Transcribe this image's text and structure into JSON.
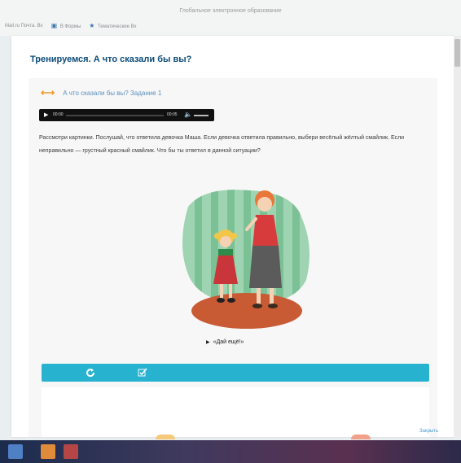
{
  "browser": {
    "window_title": "Глобальное электронное образование",
    "bookmarks": [
      {
        "label": "Mail.ru Почта. Вх",
        "icon": "mail-icon"
      },
      {
        "label": "В Формы",
        "icon": "forms-icon"
      },
      {
        "label": "Тематические Вх",
        "icon": "bookmark-icon"
      }
    ]
  },
  "page": {
    "title": "Тренируемся. А что сказали бы вы?",
    "task": {
      "icon": "arrows-icon",
      "label": "А что сказали бы вы? Задание 1"
    },
    "player": {
      "time_current": "00:00",
      "time_total": "00:05",
      "progress": 0
    },
    "instructions": "Рассмотри картинки. Послушай, что ответила девочка Маша. Если девочка ответила правильно, выбери весёлый жёлтый смайлик. Если неправильно — грустный красный смайлик. Что бы ты ответил в данной ситуации?",
    "caption": "«Дай ещё!»",
    "toolbar": {
      "buttons": [
        {
          "name": "reset-button",
          "icon": "refresh-icon"
        },
        {
          "name": "check-button",
          "icon": "checkmark-icon"
        }
      ]
    },
    "next_label": "Закрыть"
  },
  "colors": {
    "title": "#0b4b79",
    "task_icon": "#f09a2a",
    "toolbar": "#27b2cf",
    "link": "#4a9bd1"
  }
}
